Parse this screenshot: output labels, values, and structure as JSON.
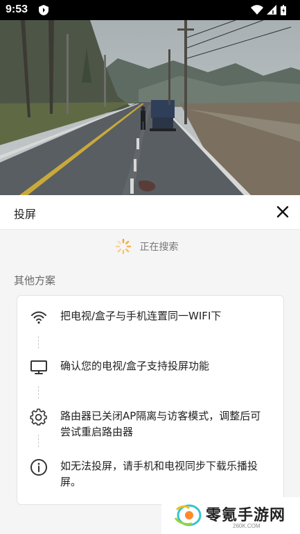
{
  "status_bar": {
    "time": "9:53",
    "icons": [
      "app-shield-icon",
      "wifi-icon",
      "signal-icon",
      "battery-icon"
    ]
  },
  "video": {
    "content": "road-with-truck-scene"
  },
  "cast_panel": {
    "title": "投屏",
    "searching_text": "正在搜索",
    "section_label": "其他方案",
    "steps": [
      {
        "icon": "wifi-icon",
        "text": "把电视/盒子与手机连置同一WIFI下"
      },
      {
        "icon": "monitor-icon",
        "text": "确认您的电视/盒子支持投屏功能"
      },
      {
        "icon": "gear-icon",
        "text": "路由器已关闭AP隔离与访客模式，调整后可\n尝试重启路由器"
      },
      {
        "icon": "info-icon",
        "text": "如无法投屏，请手机和电视同步下载乐播投屏。"
      }
    ]
  },
  "watermark": {
    "text": "零氪手游网",
    "sub": "260K.COM"
  },
  "colors": {
    "status_bar": "#000000",
    "panel_bg": "#f5f5f5",
    "card_bg": "#ffffff",
    "spinner": "#f5a623"
  }
}
